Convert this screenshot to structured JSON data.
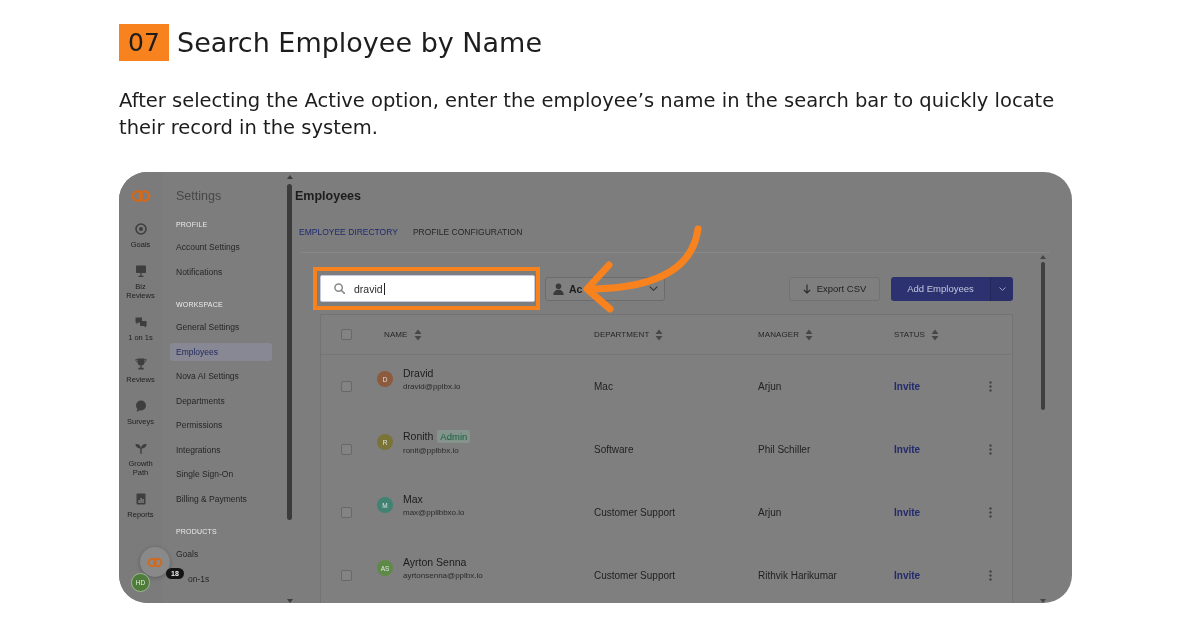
{
  "step": {
    "number": "07",
    "title": "Search Employee by Name",
    "description": "After selecting the Active option, enter the employee’s name in the search bar to quickly locate their record in the system."
  },
  "nav_rail": {
    "items": [
      {
        "label": "Goals",
        "selected": false
      },
      {
        "label": "Biz Reviews",
        "selected": false
      },
      {
        "label": "1 on 1s",
        "selected": false
      },
      {
        "label": "Reviews",
        "selected": false
      },
      {
        "label": "Surveys",
        "selected": false
      },
      {
        "label": "Growth Path",
        "selected": false
      },
      {
        "label": "Reports",
        "selected": false
      }
    ]
  },
  "settings_menu": {
    "title": "Settings",
    "sections": [
      {
        "heading": "PROFILE",
        "items": [
          {
            "label": "Account Settings",
            "selected": false
          },
          {
            "label": "Notifications",
            "selected": false
          }
        ]
      },
      {
        "heading": "WORKSPACE",
        "items": [
          {
            "label": "General Settings",
            "selected": false
          },
          {
            "label": "Employees",
            "selected": true
          },
          {
            "label": "Nova AI Settings",
            "selected": false
          },
          {
            "label": "Departments",
            "selected": false
          },
          {
            "label": "Permissions",
            "selected": false
          },
          {
            "label": "Integrations",
            "selected": false
          },
          {
            "label": "Single Sign-On",
            "selected": false
          },
          {
            "label": "Billing & Payments",
            "selected": false
          }
        ]
      },
      {
        "heading": "PRODUCTS",
        "items": [
          {
            "label": "Goals",
            "selected": false
          },
          {
            "label": "on-1s",
            "selected": false
          }
        ]
      }
    ]
  },
  "launcher": {
    "badge": "18"
  },
  "user_avatar": {
    "initials": "HD"
  },
  "page": {
    "title": "Employees",
    "tabs": [
      {
        "label": "EMPLOYEE DIRECTORY",
        "selected": true
      },
      {
        "label": "PROFILE CONFIGURATION",
        "selected": false
      }
    ],
    "search": {
      "value": "dravid",
      "highlighted": true
    },
    "status_filter": {
      "value": "Ac"
    },
    "export_button": "Export CSV",
    "add_button": "Add Employees",
    "table": {
      "all_checked": false,
      "columns": [
        "NAME",
        "DEPARTMENT",
        "MANAGER",
        "STATUS"
      ],
      "rows": [
        {
          "initials": "D",
          "color": "#8c5b3d",
          "name": "Dravid",
          "email": "dravid@pplbx.io",
          "department": "Mac",
          "manager": "Arjun",
          "status": "Invite",
          "checked": false
        },
        {
          "initials": "R",
          "color": "#7b7439",
          "name": "Ronith",
          "badge": "Admin",
          "email": "ronit@pplbbx.io",
          "department": "Software",
          "manager": "Phil Schiller",
          "status": "Invite",
          "checked": false
        },
        {
          "initials": "M",
          "color": "#408373",
          "name": "Max",
          "email": "max@ppllbbxo.io",
          "department": "Customer Support",
          "manager": "Arjun",
          "status": "Invite",
          "checked": false
        },
        {
          "initials": "AS",
          "color": "#5e8a47",
          "name": "Ayrton Senna",
          "email": "ayrtonsenna@pplbx.io",
          "department": "Customer Support",
          "manager": "Rithvik Harikumar",
          "status": "Invite",
          "checked": false
        }
      ]
    }
  }
}
